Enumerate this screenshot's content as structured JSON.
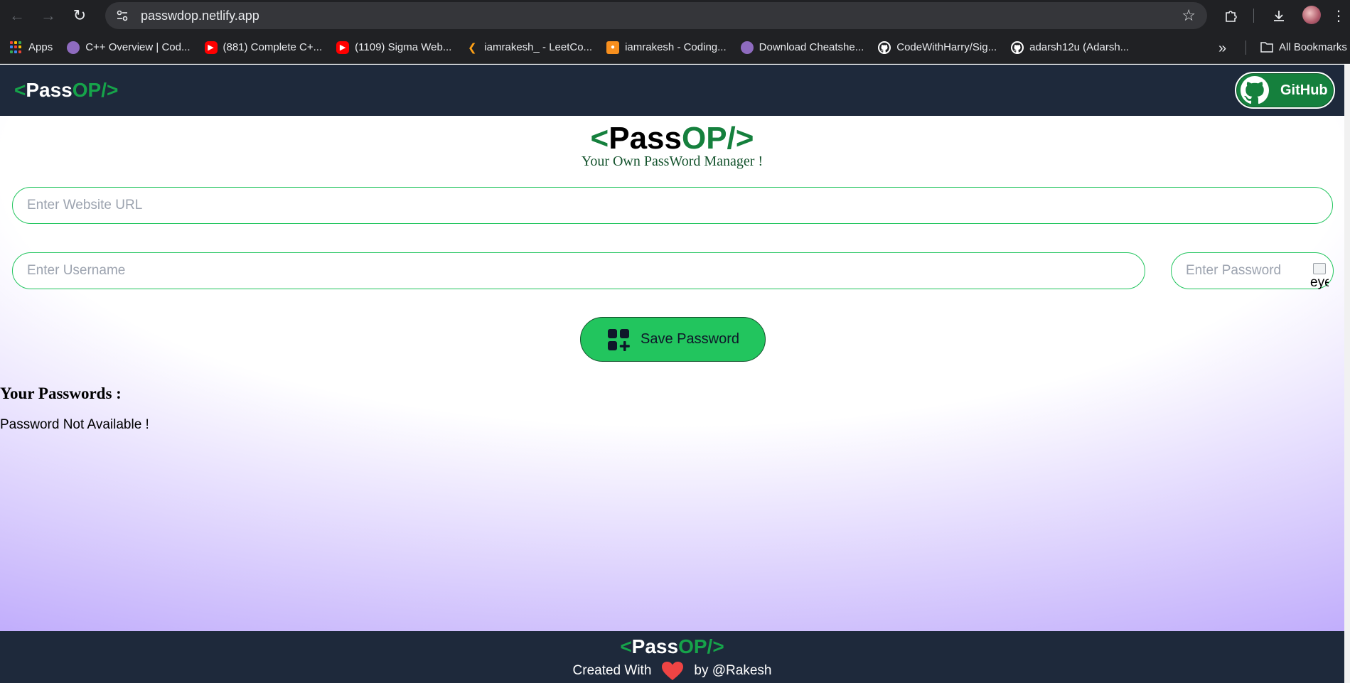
{
  "browser": {
    "url": "passwdop.netlify.app",
    "bookmarks": [
      {
        "label": "Apps",
        "icon": "apps-grid-icon"
      },
      {
        "label": "C++ Overview | Cod...",
        "icon": "avatar-icon"
      },
      {
        "label": "(881) Complete C+...",
        "icon": "youtube-icon"
      },
      {
        "label": "(1109) Sigma Web...",
        "icon": "youtube-icon"
      },
      {
        "label": "iamrakesh_ - LeetCo...",
        "icon": "leetcode-icon"
      },
      {
        "label": "iamrakesh - Coding...",
        "icon": "codingninjas-icon"
      },
      {
        "label": "Download Cheatshe...",
        "icon": "avatar-icon"
      },
      {
        "label": "CodeWithHarry/Sig...",
        "icon": "github-icon"
      },
      {
        "label": "adarsh12u (Adarsh...",
        "icon": "github-icon"
      }
    ],
    "all_bookmarks": "All Bookmarks",
    "overflow_label": "»"
  },
  "nav": {
    "logo_open": "<",
    "logo_pass": "Pass",
    "logo_op": "OP/",
    "logo_close": ">",
    "github_label": "GitHub"
  },
  "hero": {
    "logo_open": "<",
    "logo_pass": "Pass",
    "logo_op": "OP/",
    "logo_close": ">",
    "tagline": "Your Own PassWord Manager !"
  },
  "form": {
    "url_placeholder": "Enter Website URL",
    "username_placeholder": "Enter Username",
    "password_placeholder": "Enter Password",
    "eye_alt": "eye",
    "save_label": "Save Password"
  },
  "passwords": {
    "heading": "Your Passwords :",
    "empty_text": "Password Not Available !"
  },
  "footer": {
    "logo_open": "<",
    "logo_pass": "Pass",
    "logo_op": "OP/",
    "logo_close": ">",
    "created_with": "Created With",
    "by": "by @Rakesh"
  },
  "colors": {
    "nav_bg": "#1e293b",
    "accent_green": "#16a34a",
    "button_green": "#22c55e",
    "gradient_purple": "#a78bfa"
  }
}
